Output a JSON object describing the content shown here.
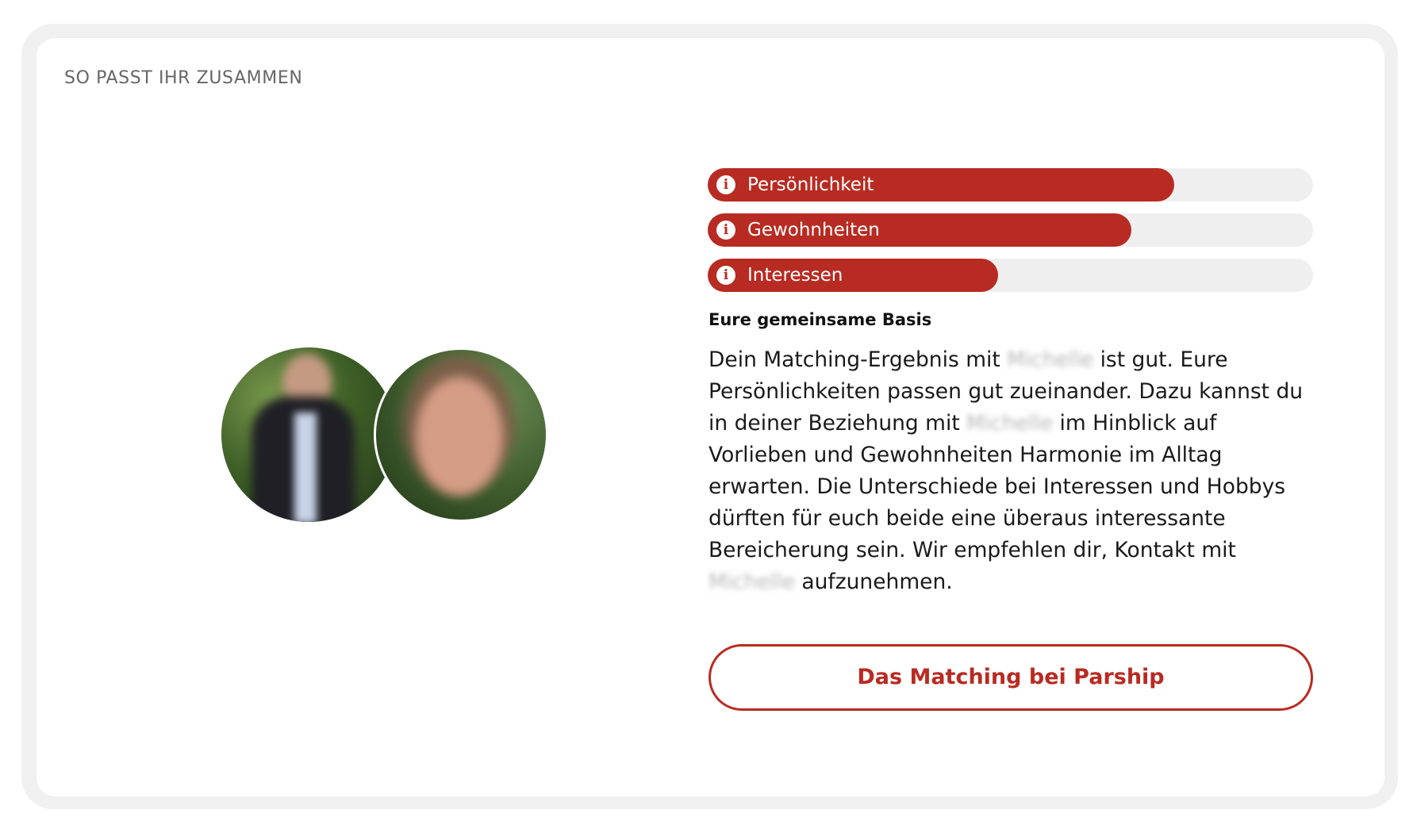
{
  "section": {
    "title": "SO PASST IHR ZUSAMMEN"
  },
  "bars": [
    {
      "label": "Persönlichkeit",
      "icon": "info-icon",
      "fill_fraction": 0.77
    },
    {
      "label": "Gewohnheiten",
      "icon": "info-icon",
      "fill_fraction": 0.7
    },
    {
      "label": "Interessen",
      "icon": "info-icon",
      "fill_fraction": 0.48
    }
  ],
  "basis": {
    "heading": "Eure gemeinsame Basis",
    "match_name": "Michelle",
    "text_1": "Dein Matching-Ergebnis mit ",
    "text_2": " ist gut. Eure Persönlichkeiten passen gut zueinander. Dazu kannst du in deiner Beziehung mit ",
    "text_3": " im Hinblick auf Vorlieben und Gewohnheiten Harmonie im Alltag erwarten. Die Unterschiede bei Interessen und Hobbys dürften für euch beide eine überaus interessante Bereicherung sein. Wir empfehlen dir, Kontakt mit ",
    "text_4": " aufzunehmen."
  },
  "cta": {
    "label": "Das Matching bei Parship"
  },
  "colors": {
    "accent": "#b82b22",
    "track": "#efefef",
    "frame": "#f0f0f0"
  }
}
